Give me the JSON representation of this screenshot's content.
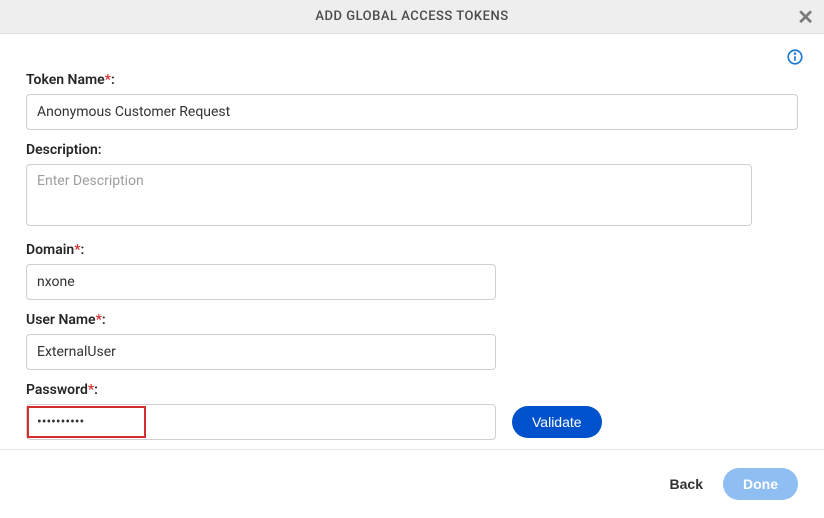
{
  "header": {
    "title": "ADD GLOBAL ACCESS TOKENS"
  },
  "fields": {
    "tokenName": {
      "label": "Token Name",
      "required": true,
      "value": "Anonymous Customer Request"
    },
    "description": {
      "label": "Description:",
      "required": false,
      "value": "",
      "placeholder": "Enter Description"
    },
    "domain": {
      "label": "Domain",
      "required": true,
      "value": "nxone"
    },
    "userName": {
      "label": "User Name",
      "required": true,
      "value": "ExternalUser"
    },
    "password": {
      "label": "Password",
      "required": true,
      "value": "••••••••••"
    }
  },
  "buttons": {
    "validate": "Validate",
    "back": "Back",
    "done": "Done"
  }
}
